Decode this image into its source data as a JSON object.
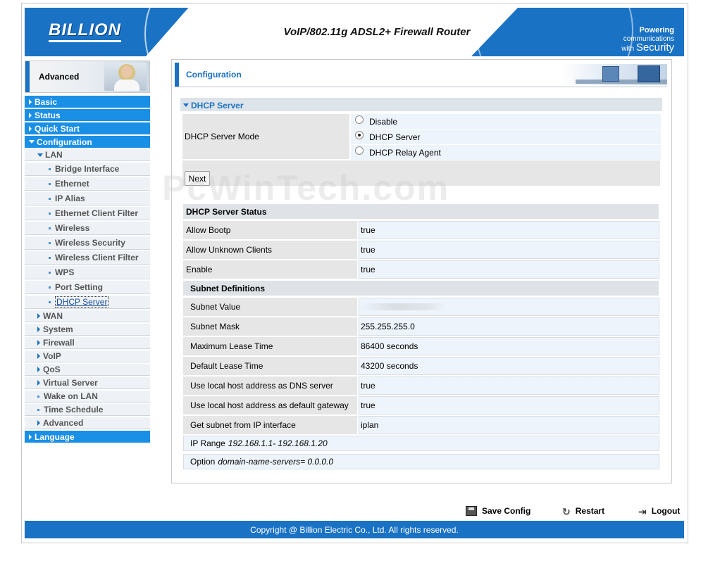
{
  "header": {
    "logo": "BILLION",
    "product": "VoIP/802.11g ADSL2+ Firewall Router",
    "tagline_bold": "Powering",
    "tagline_small": "communications",
    "tagline_with": "with",
    "tagline_big": "Security"
  },
  "sidebar": {
    "mode_label": "Advanced",
    "top_items": [
      "Basic",
      "Status",
      "Quick Start",
      "Configuration"
    ],
    "lan_label": "LAN",
    "lan_items": [
      "Bridge Interface",
      "Ethernet",
      "IP Alias",
      "Ethernet Client Filter",
      "Wireless",
      "Wireless Security",
      "Wireless Client Filter",
      "WPS",
      "Port Setting",
      "DHCP Server"
    ],
    "config_items": [
      "WAN",
      "System",
      "Firewall",
      "VoIP",
      "QoS",
      "Virtual Server",
      "Wake on LAN",
      "Time Schedule",
      "Advanced"
    ],
    "language": "Language"
  },
  "main": {
    "title": "Configuration",
    "section": "DHCP Server",
    "mode_label": "DHCP Server Mode",
    "options": [
      "Disable",
      "DHCP Server",
      "DHCP Relay Agent"
    ],
    "selected_option": "DHCP Server",
    "next_label": "Next",
    "watermark": "PcWinTech.com",
    "status_title": "DHCP Server Status",
    "status_rows": [
      {
        "key": "Allow Bootp",
        "value": "true"
      },
      {
        "key": "Allow Unknown Clients",
        "value": "true"
      },
      {
        "key": "Enable",
        "value": "true"
      }
    ],
    "subnet_title": "Subnet Definitions",
    "subnet_rows": [
      {
        "key": "Subnet Value",
        "value": ""
      },
      {
        "key": "Subnet Mask",
        "value": "255.255.255.0"
      },
      {
        "key": "Maximum Lease Time",
        "value": "86400 seconds"
      },
      {
        "key": "Default Lease Time",
        "value": "43200 seconds"
      },
      {
        "key": "Use local host address as DNS server",
        "value": "true"
      },
      {
        "key": "Use local host address as default gateway",
        "value": "true"
      },
      {
        "key": "Get subnet from IP interface",
        "value": "iplan"
      }
    ],
    "ip_range_label": "IP Range",
    "ip_range_value": "192.168.1.1- 192.168.1.20",
    "option_label": "Option",
    "option_value": "domain-name-servers= 0.0.0.0"
  },
  "footer": {
    "save": "Save Config",
    "restart": "Restart",
    "logout": "Logout",
    "copyright": "Copyright @ Billion Electric Co., Ltd. All rights reserved."
  },
  "colors": {
    "accent": "#1a72c4",
    "nav_top": "#1a8fe6",
    "value_bg": "#edf4fb"
  }
}
